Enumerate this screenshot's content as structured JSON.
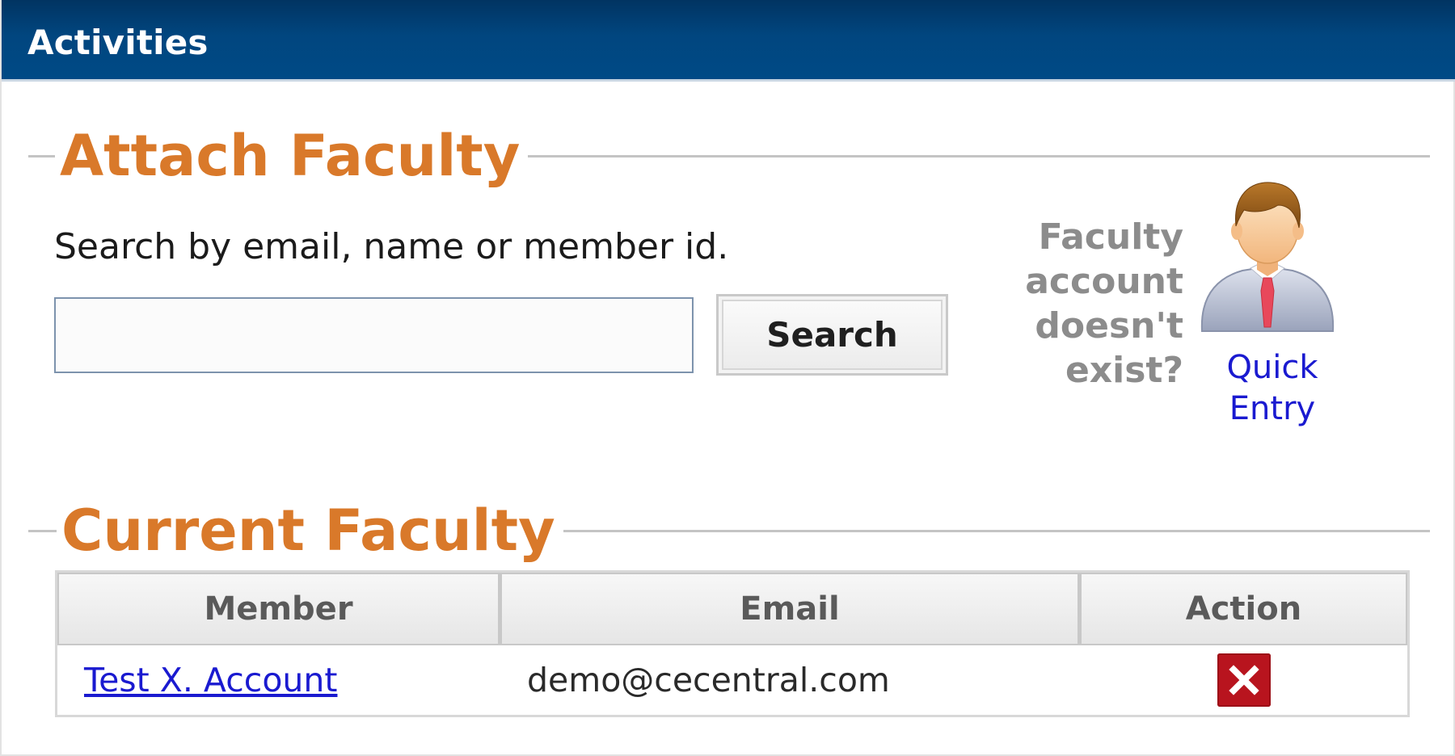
{
  "header": {
    "title": "Activities"
  },
  "attach_section": {
    "title": "Attach Faculty",
    "search_hint": "Search by email, name or member id.",
    "search_input_value": "",
    "search_button_label": "Search",
    "quick_entry_question": [
      "Faculty",
      "account",
      "doesn't",
      "exist?"
    ],
    "quick_entry_link": [
      "Quick",
      "Entry"
    ]
  },
  "current_section": {
    "title": "Current Faculty",
    "table": {
      "columns": [
        "Member",
        "Email",
        "Action"
      ],
      "rows": [
        {
          "member": "Test X. Account",
          "email": "demo@cecentral.com",
          "action_icon": "close-icon"
        }
      ]
    }
  },
  "colors": {
    "header_bg": "#01467f",
    "section_title": "#d9792a",
    "link": "#1a1ad0",
    "remove_button": "#b8141e",
    "muted_text": "#8c8c8c"
  },
  "icons": {
    "quick_entry": "person-avatar-icon",
    "remove": "close-icon"
  }
}
